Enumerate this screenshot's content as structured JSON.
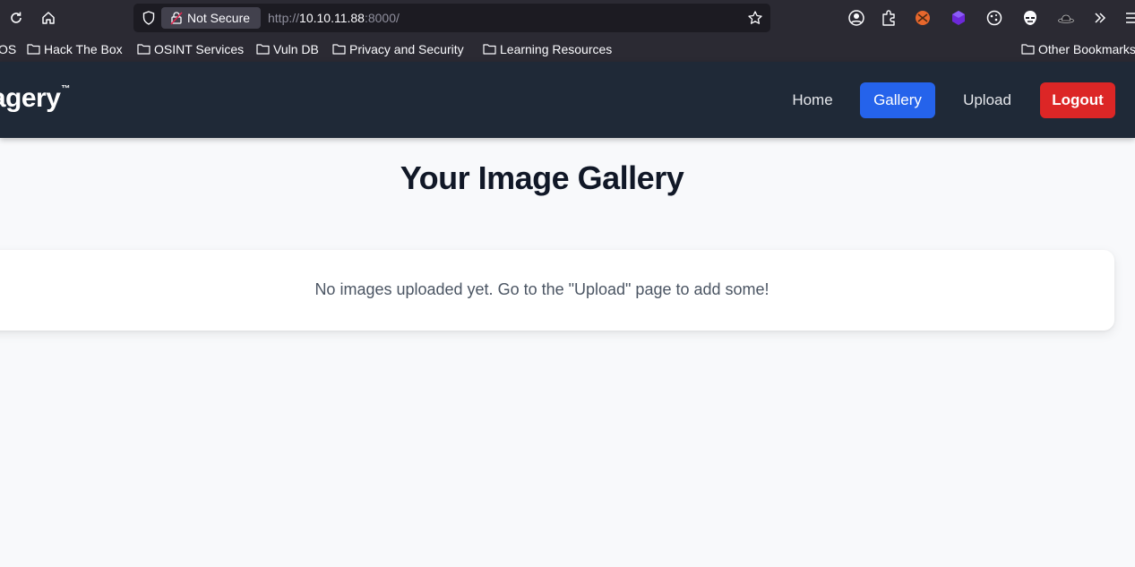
{
  "browser": {
    "security_label": "Not Secure",
    "url_scheme": "http://",
    "url_host": "10.10.11.88",
    "url_port": ":8000/",
    "bookmarks": [
      {
        "label": "OS"
      },
      {
        "label": "Hack The Box"
      },
      {
        "label": "OSINT Services"
      },
      {
        "label": "Vuln DB"
      },
      {
        "label": "Privacy and Security"
      },
      {
        "label": "Learning Resources"
      }
    ],
    "other_bookmarks": "Other Bookmarks"
  },
  "nav": {
    "brand": "nagery",
    "brand_mark": "™",
    "links": {
      "home": "Home",
      "gallery": "Gallery",
      "upload": "Upload",
      "logout": "Logout"
    }
  },
  "main": {
    "title": "Your Image Gallery",
    "empty_message": "No images uploaded yet. Go to the \"Upload\" page to add some!"
  },
  "colors": {
    "navbar": "#1f2937",
    "gallery_active": "#2563eb",
    "logout": "#dc2626"
  }
}
